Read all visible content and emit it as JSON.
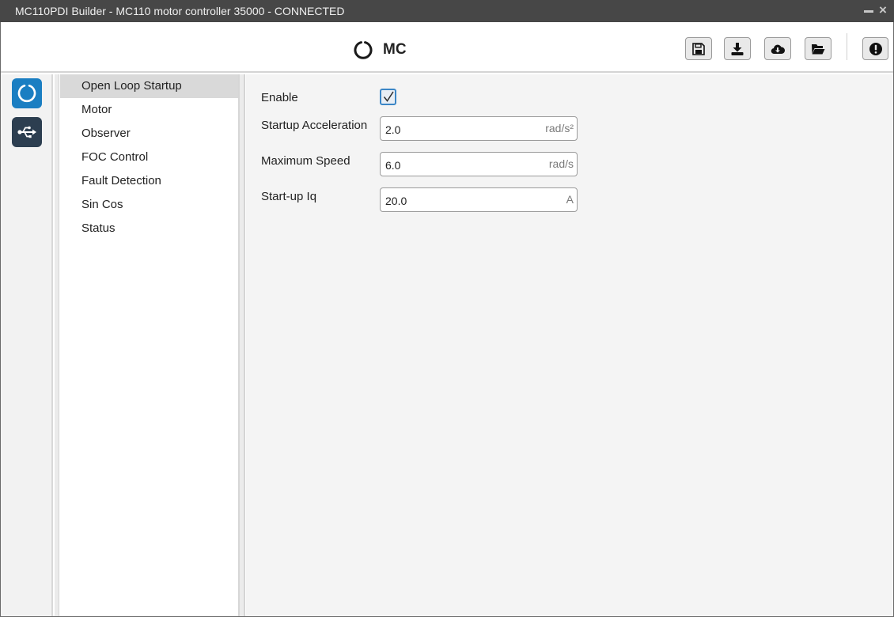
{
  "window": {
    "title": "MC110PDI Builder - MC110 motor controller 35000 - CONNECTED",
    "minimize_label": "–",
    "close_label": "×"
  },
  "header": {
    "brand": "MC",
    "toolbar": [
      {
        "name": "save-button",
        "icon": "floppy-disk-icon"
      },
      {
        "name": "download-button",
        "icon": "download-icon"
      },
      {
        "name": "cloud-download-button",
        "icon": "cloud-download-icon"
      },
      {
        "name": "open-folder-button",
        "icon": "folder-open-icon"
      },
      {
        "name": "info-button",
        "icon": "exclamation-icon"
      }
    ]
  },
  "rail": {
    "items": [
      {
        "name": "mc-icon",
        "color": "#1a7ec2"
      },
      {
        "name": "usb-icon",
        "color": "#2c3e50"
      }
    ]
  },
  "menu": {
    "items": [
      {
        "label": "Open Loop Startup",
        "active": true
      },
      {
        "label": "Motor"
      },
      {
        "label": "Observer"
      },
      {
        "label": "FOC Control"
      },
      {
        "label": "Fault Detection"
      },
      {
        "label": "Sin Cos"
      },
      {
        "label": "Status"
      }
    ]
  },
  "form": {
    "enable_label": "Enable",
    "enable_checked": true,
    "fields": [
      {
        "label": "Startup Acceleration",
        "value": "2.0",
        "unit": "rad/s²"
      },
      {
        "label": "Maximum Speed",
        "value": "6.0",
        "unit": "rad/s"
      },
      {
        "label": "Start-up Iq",
        "value": "20.0",
        "unit": "A"
      }
    ]
  },
  "colors": {
    "accent": "#3b86c6",
    "titlebar": "#474747",
    "active_menu": "#d9d9d9"
  }
}
